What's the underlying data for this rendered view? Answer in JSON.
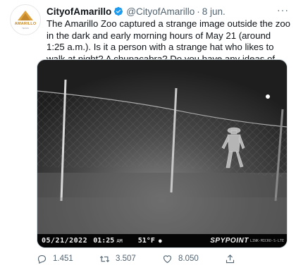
{
  "tweet": {
    "avatar_text": "AMARILLO",
    "avatar_subtext": "TEXAS",
    "display_name": "CityofAmarillo",
    "handle": "@CityofAmarillo",
    "separator": "·",
    "date": "8 jun.",
    "more_label": "···",
    "text": "The Amarillo Zoo captured a strange image outside the zoo in the dark and early morning hours of May 21 (around 1:25 a.m.). Is it a person with a strange hat who likes to walk at night? A chupacabra? Do you have any ideas of what this UAO- Unidentified Amarillo Object could be?",
    "verified_color": "#1d9bf0"
  },
  "media": {
    "date": "05/21/2022",
    "time": "01:25",
    "ampm": "AM",
    "temperature": "51°F",
    "brand": "SPYPOINT",
    "model": "LINK-MICRO-S-LTE"
  },
  "actions": {
    "replies": "1.451",
    "retweets": "3.507",
    "likes": "8.050",
    "reply_icon": "reply-icon",
    "retweet_icon": "retweet-icon",
    "like_icon": "heart-icon",
    "share_icon": "share-icon"
  }
}
